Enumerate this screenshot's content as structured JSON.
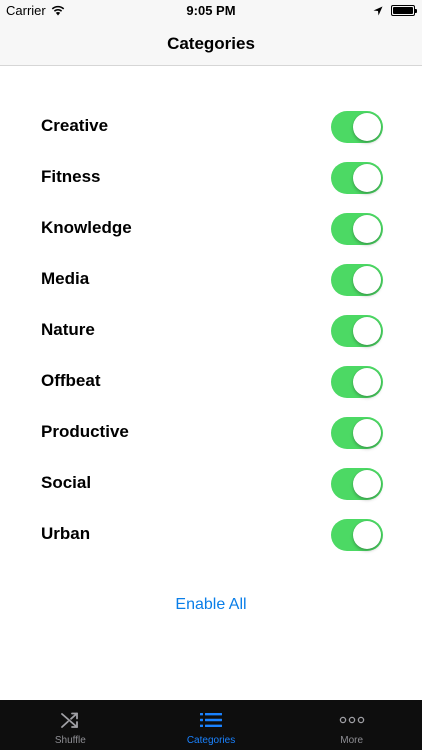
{
  "status_bar": {
    "carrier": "Carrier",
    "time": "9:05 PM"
  },
  "nav": {
    "title": "Categories"
  },
  "categories": [
    {
      "label": "Creative",
      "enabled": true
    },
    {
      "label": "Fitness",
      "enabled": true
    },
    {
      "label": "Knowledge",
      "enabled": true
    },
    {
      "label": "Media",
      "enabled": true
    },
    {
      "label": "Nature",
      "enabled": true
    },
    {
      "label": "Offbeat",
      "enabled": true
    },
    {
      "label": "Productive",
      "enabled": true
    },
    {
      "label": "Social",
      "enabled": true
    },
    {
      "label": "Urban",
      "enabled": true
    }
  ],
  "enable_all_label": "Enable All",
  "tabs": [
    {
      "label": "Shuffle",
      "icon": "shuffle-icon",
      "active": false
    },
    {
      "label": "Categories",
      "icon": "list-icon",
      "active": true
    },
    {
      "label": "More",
      "icon": "more-icon",
      "active": false
    }
  ],
  "colors": {
    "switch_on": "#4cd964",
    "accent": "#0a7ee8",
    "tab_active": "#1a82ff",
    "tab_inactive": "#8e8e93"
  }
}
